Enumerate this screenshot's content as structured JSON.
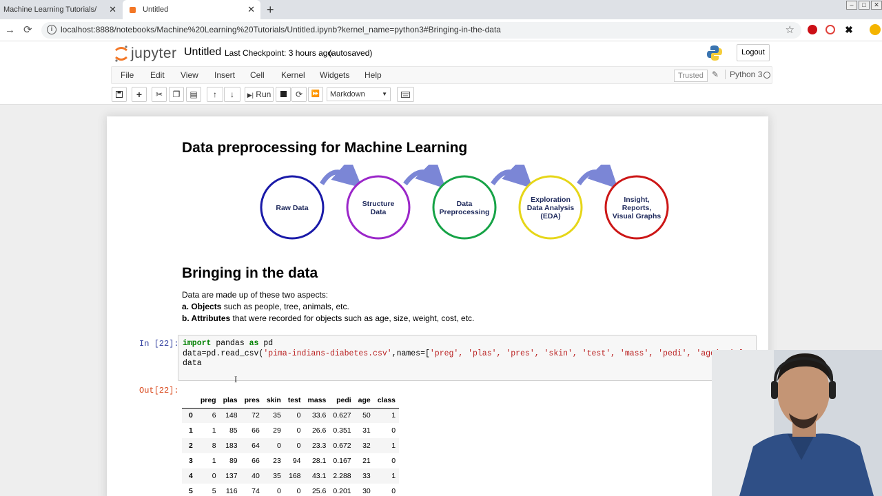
{
  "browser": {
    "tabs": [
      {
        "title": "Machine Learning Tutorials/",
        "active": false
      },
      {
        "title": "Untitled",
        "active": true
      }
    ],
    "url": "localhost:8888/notebooks/Machine%20Learning%20Tutorials/Untitled.ipynb?kernel_name=python3#Bringing-in-the-data"
  },
  "jupyter": {
    "logo_text": "jupyter",
    "notebook_title": "Untitled",
    "checkpoint": "Last Checkpoint: 3 hours ago",
    "autosave": "(autosaved)",
    "logout_label": "Logout",
    "menu": [
      "File",
      "Edit",
      "View",
      "Insert",
      "Cell",
      "Kernel",
      "Widgets",
      "Help"
    ],
    "trusted_label": "Trusted",
    "kernel_name": "Python 3",
    "run_label": "Run",
    "cell_type": "Markdown"
  },
  "notebook": {
    "heading1": "Data preprocessing for Machine Learning",
    "pipeline": [
      {
        "label": [
          "Raw Data"
        ],
        "color": "#1a1aa8"
      },
      {
        "label": [
          "Structure",
          "Data"
        ],
        "color": "#9b27c9"
      },
      {
        "label": [
          "Data",
          "Preprocessing"
        ],
        "color": "#17a347"
      },
      {
        "label": [
          "Exploration",
          "Data Analysis",
          "(EDA)"
        ],
        "color": "#e6d619"
      },
      {
        "label": [
          "Insight,",
          "Reports,",
          "Visual Graphs"
        ],
        "color": "#cc1717"
      }
    ],
    "heading2": "Bringing in the data",
    "intro": "Data are made up of these two aspects:",
    "aspect_a_bold": "a. Objects",
    "aspect_a_rest": " such as people, tree, animals, etc.",
    "aspect_b_bold": "b. Attributes",
    "aspect_b_rest": " that were recorded for objects such as age, size, weight, cost, etc.",
    "in_prompt": "In [22]:",
    "out_prompt": "Out[22]:",
    "code": {
      "line1_kw1": "import",
      "line1_mid": " pandas ",
      "line1_kw2": "as",
      "line1_end": " pd",
      "line2_pre": "data=pd.read_csv(",
      "line2_str": "'pima-indians-diabetes.csv'",
      "line2_mid": ",names=[",
      "line2_names": "'preg', 'plas', 'pres', 'skin', 'test', 'mass', 'pedi', 'age', 'class'",
      "line2_end": "])",
      "line3": "data"
    },
    "table": {
      "columns": [
        "",
        "preg",
        "plas",
        "pres",
        "skin",
        "test",
        "mass",
        "pedi",
        "age",
        "class"
      ],
      "rows": [
        [
          "0",
          "6",
          "148",
          "72",
          "35",
          "0",
          "33.6",
          "0.627",
          "50",
          "1"
        ],
        [
          "1",
          "1",
          "85",
          "66",
          "29",
          "0",
          "26.6",
          "0.351",
          "31",
          "0"
        ],
        [
          "2",
          "8",
          "183",
          "64",
          "0",
          "0",
          "23.3",
          "0.672",
          "32",
          "1"
        ],
        [
          "3",
          "1",
          "89",
          "66",
          "23",
          "94",
          "28.1",
          "0.167",
          "21",
          "0"
        ],
        [
          "4",
          "0",
          "137",
          "40",
          "35",
          "168",
          "43.1",
          "2.288",
          "33",
          "1"
        ],
        [
          "5",
          "5",
          "116",
          "74",
          "0",
          "0",
          "25.6",
          "0.201",
          "30",
          "0"
        ]
      ]
    }
  }
}
